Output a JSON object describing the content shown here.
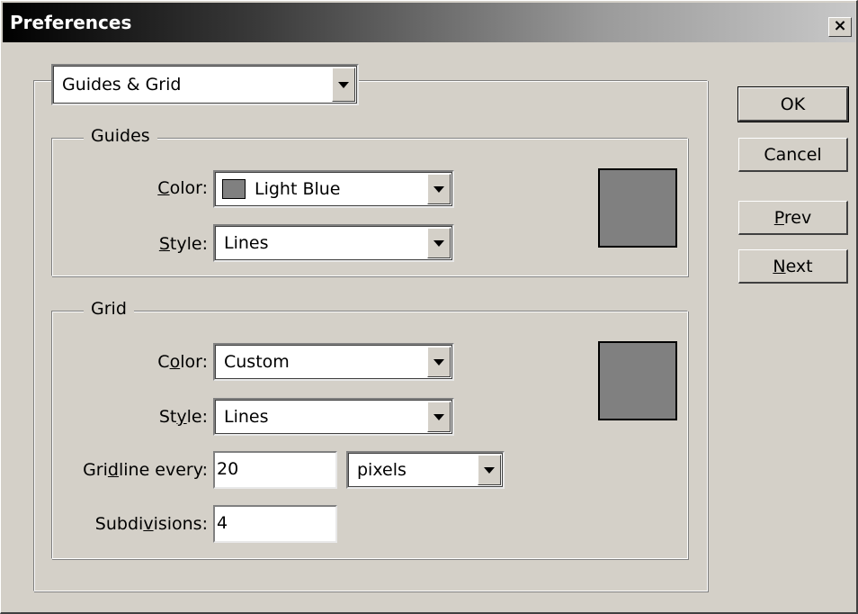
{
  "window": {
    "title": "Preferences",
    "close_glyph": "×"
  },
  "section_select": {
    "value": "Guides & Grid"
  },
  "guides": {
    "legend": "Guides",
    "color_label": "Color:",
    "color_value": "Light Blue",
    "style_label": "Style:",
    "style_value": "Lines",
    "swatch_color": "#808080"
  },
  "grid": {
    "legend": "Grid",
    "color_label": "Color:",
    "color_value": "Custom",
    "style_label": "Style:",
    "style_value": "Lines",
    "gridline_label": "Gridline every:",
    "gridline_value": "20",
    "gridline_units": "pixels",
    "subdivisions_label": "Subdivisions:",
    "subdivisions_value": "4",
    "swatch_color": "#808080"
  },
  "buttons": {
    "ok": "OK",
    "cancel": "Cancel",
    "prev": "Prev",
    "next": "Next"
  }
}
